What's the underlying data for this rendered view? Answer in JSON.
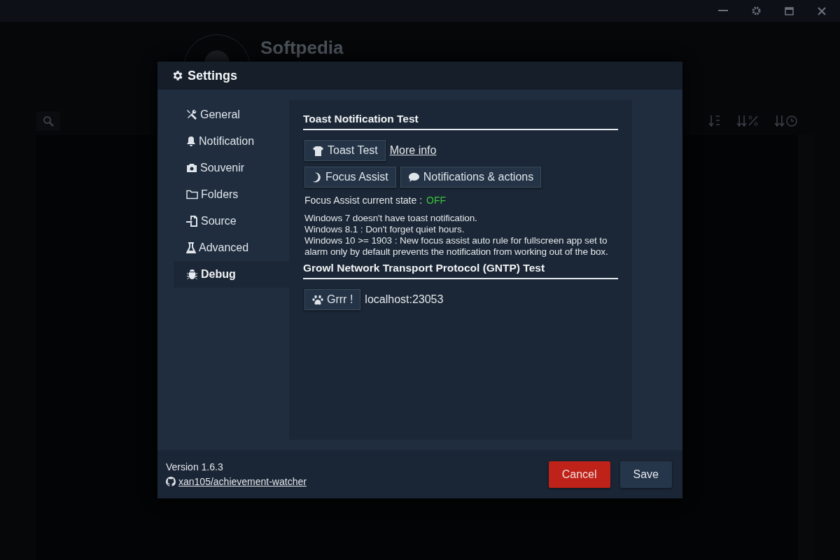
{
  "background": {
    "profile_name": "Softpedia"
  },
  "dialog": {
    "title": "Settings",
    "sidebar": [
      {
        "label": "General",
        "selected": false
      },
      {
        "label": "Notification",
        "selected": false
      },
      {
        "label": "Souvenir",
        "selected": false
      },
      {
        "label": "Folders",
        "selected": false
      },
      {
        "label": "Source",
        "selected": false
      },
      {
        "label": "Advanced",
        "selected": false
      },
      {
        "label": "Debug",
        "selected": true
      }
    ],
    "toast_section": {
      "heading": "Toast Notification Test",
      "toast_button": "Toast Test",
      "more_info_link": "More info",
      "focus_button": "Focus Assist",
      "notifications_button": "Notifications & actions",
      "state_label": "Focus Assist current state :",
      "state_value": "OFF",
      "state_on": false,
      "notes": [
        "Windows 7 doesn't have toast notification.",
        "Windows 8.1 : Don't forget quiet hours.",
        "Windows 10 >= 1903 : New focus assist auto rule for fullscreen app set to alarm only by default prevents the notification from working out of the box."
      ]
    },
    "gntp_section": {
      "heading": "Growl Network Transport Protocol (GNTP) Test",
      "button": "Grrr !",
      "address": "localhost:23053"
    },
    "footer": {
      "version": "Version 1.6.3",
      "repo_link": "xan105/achievement-watcher",
      "buttons": [
        {
          "label": "Cancel",
          "kind": "danger"
        },
        {
          "label": "Save",
          "kind": "default"
        }
      ]
    }
  }
}
